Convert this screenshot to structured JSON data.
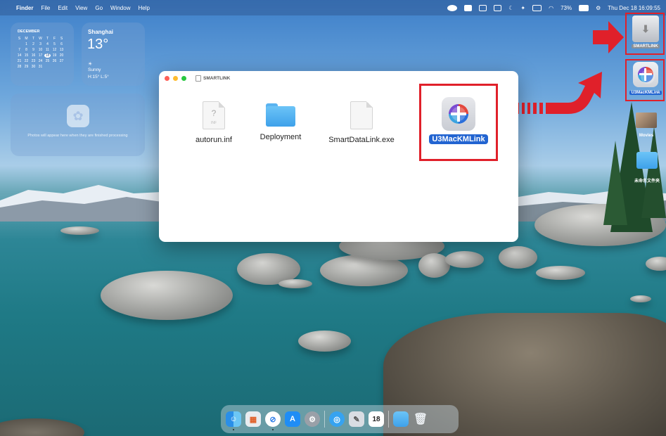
{
  "menubar": {
    "app": "Finder",
    "items": [
      "File",
      "Edit",
      "View",
      "Go",
      "Window",
      "Help"
    ],
    "battery": "73%",
    "clock": "Thu Dec 18  16:09:55"
  },
  "calendar": {
    "month": "DECEMBER",
    "weekdays": [
      "S",
      "M",
      "T",
      "W",
      "T",
      "F",
      "S"
    ],
    "days": [
      "",
      "1",
      "2",
      "3",
      "4",
      "5",
      "6",
      "7",
      "8",
      "9",
      "10",
      "11",
      "12",
      "13",
      "14",
      "15",
      "16",
      "17",
      "18",
      "19",
      "20",
      "21",
      "22",
      "23",
      "24",
      "25",
      "26",
      "27",
      "28",
      "29",
      "30",
      "31"
    ],
    "today": "18"
  },
  "weather": {
    "city": "Shanghai",
    "temp": "13°",
    "condition": "Sunny",
    "hilo": "H:15° L:5°"
  },
  "photos_widget": {
    "message": "Photos will appear here when they are finished processing"
  },
  "desktop_icons": [
    {
      "label": "SMARTLINK"
    },
    {
      "label": "U3MacKMLink"
    },
    {
      "label": "Movies"
    },
    {
      "label": "未命名文件夹"
    }
  ],
  "finder": {
    "title": "SMARTLINK",
    "items": [
      {
        "label": "autorun.inf",
        "kind": "document"
      },
      {
        "label": "Deployment",
        "kind": "folder"
      },
      {
        "label": "SmartDataLink.exe",
        "kind": "document"
      },
      {
        "label": "U3MacKMLink",
        "kind": "app"
      }
    ]
  },
  "dock": {
    "calendar_day": "18"
  },
  "colors": {
    "annotation_red": "#e0202a",
    "selection_blue": "#2264d1"
  }
}
